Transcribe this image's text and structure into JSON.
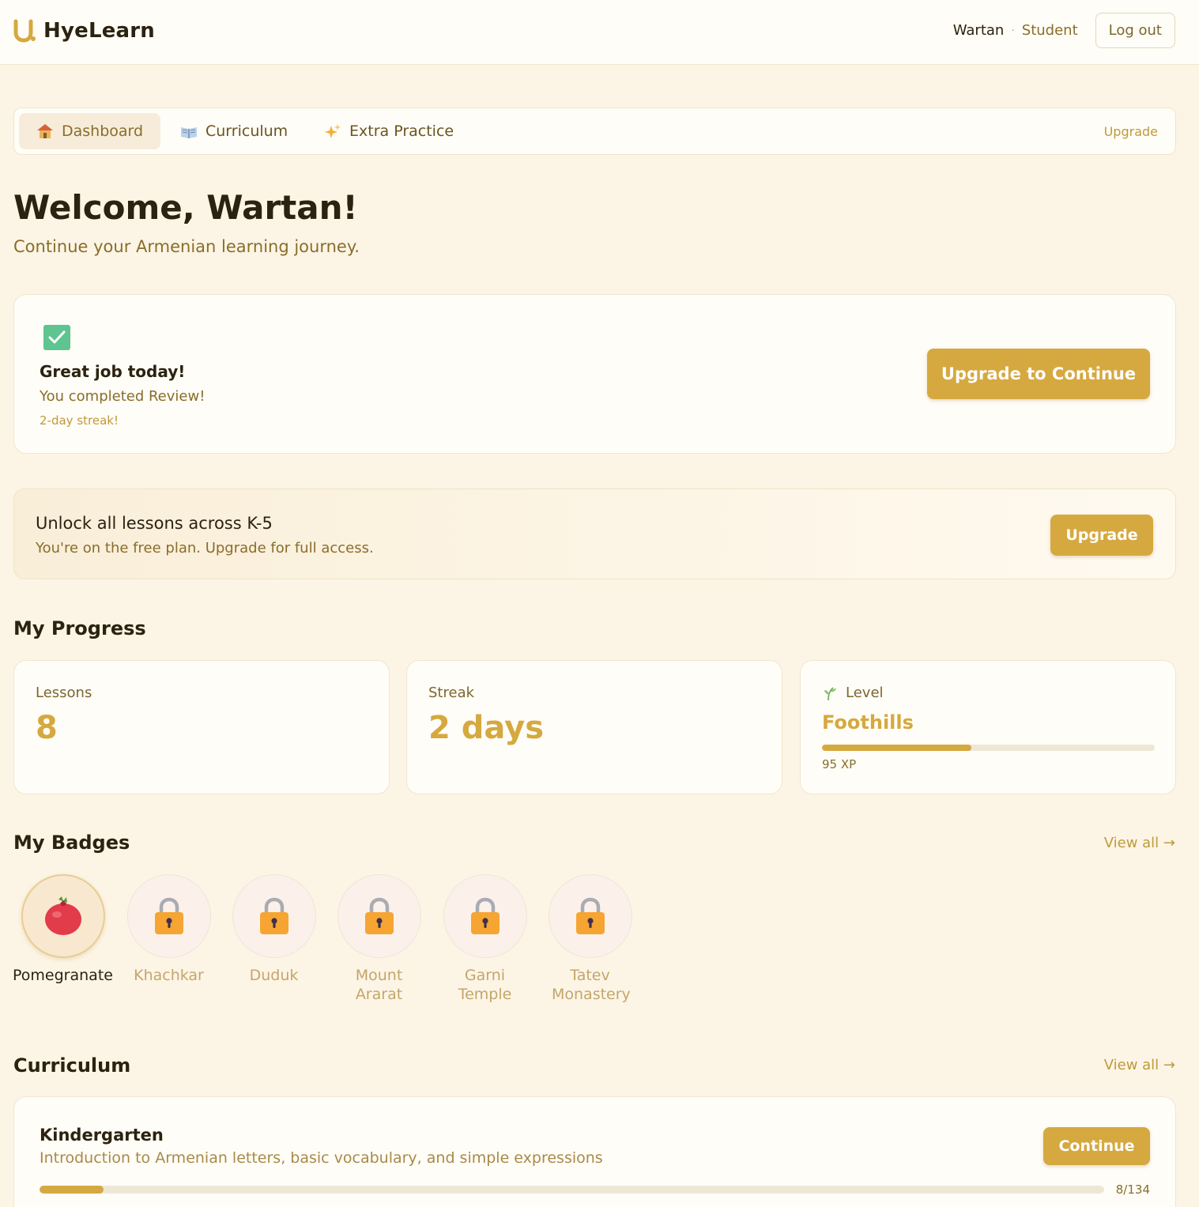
{
  "app": {
    "name": "HyeLearn"
  },
  "user": {
    "name": "Wartan",
    "role": "Student",
    "logout_label": "Log out"
  },
  "tabs": [
    {
      "label": "Dashboard",
      "icon": "house-icon",
      "active": true
    },
    {
      "label": "Curriculum",
      "icon": "book-icon",
      "active": false
    },
    {
      "label": "Extra Practice",
      "icon": "sparkles-icon",
      "active": false
    }
  ],
  "tab_upgrade_label": "Upgrade",
  "welcome": {
    "title": "Welcome, Wartan!",
    "subtitle": "Continue your Armenian learning journey."
  },
  "today": {
    "icon": "check-icon",
    "title": "Great job today!",
    "subtitle": "You completed Review!",
    "streak": "2-day streak!",
    "button_label": "Upgrade to Continue"
  },
  "unlock": {
    "title": "Unlock all lessons across K-5",
    "subtitle": "You're on the free plan. Upgrade for full access.",
    "button_label": "Upgrade"
  },
  "progress": {
    "title": "My Progress",
    "lessons": {
      "label": "Lessons",
      "value": "8"
    },
    "streak": {
      "label": "Streak",
      "value": "2 days"
    },
    "level": {
      "label": "Level",
      "icon": "sprout-icon",
      "name": "Foothills",
      "xp": "95 XP",
      "progress_fraction": 0.45
    }
  },
  "badges": {
    "title": "My Badges",
    "view_all": "View all →",
    "items": [
      {
        "name": "Pomegranate",
        "earned": true,
        "icon": "pomegranate-icon"
      },
      {
        "name": "Khachkar",
        "earned": false,
        "icon": "lock-icon"
      },
      {
        "name": "Duduk",
        "earned": false,
        "icon": "lock-icon"
      },
      {
        "name": "Mount Ararat",
        "earned": false,
        "icon": "lock-icon"
      },
      {
        "name": "Garni Temple",
        "earned": false,
        "icon": "lock-icon"
      },
      {
        "name": "Tatev Monastery",
        "earned": false,
        "icon": "lock-icon"
      }
    ]
  },
  "curriculum": {
    "title": "Curriculum",
    "view_all": "View all →",
    "items": [
      {
        "title": "Kindergarten",
        "description": "Introduction to Armenian letters, basic vocabulary, and simple expressions",
        "button_label": "Continue",
        "count": "8/134",
        "progress_fraction": 0.06
      }
    ]
  },
  "colors": {
    "accent": "#d5a940",
    "background": "#fcf5e6",
    "text": "#2b2210",
    "muted": "#8a6d2a",
    "success": "#5ec490"
  }
}
